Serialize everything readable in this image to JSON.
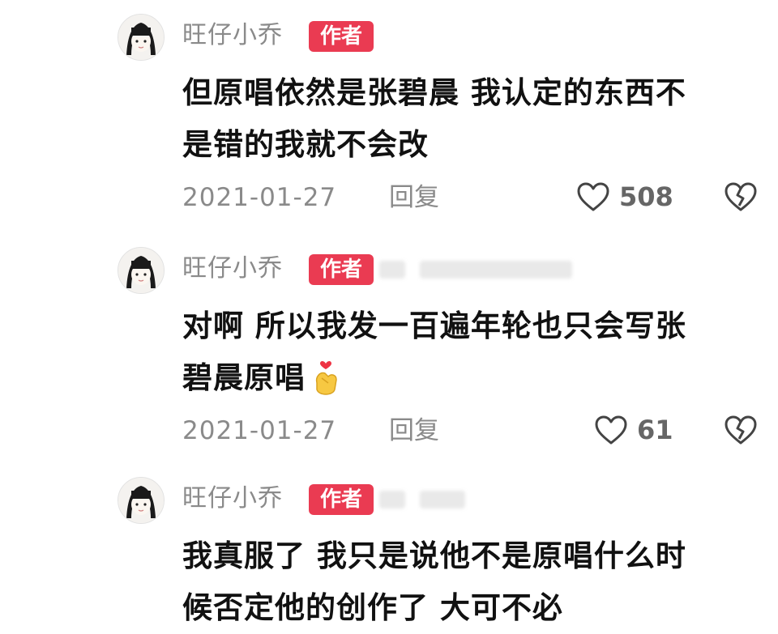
{
  "comments": [
    {
      "username": "旺仔小乔",
      "badge": "作者",
      "lines": [
        "但原唱依然是张碧晨 我认定的东西不",
        "是错的我就不会改"
      ],
      "date": "2021-01-27",
      "reply_label": "回复",
      "likes": "508"
    },
    {
      "username": "旺仔小乔",
      "badge": "作者",
      "lines": [
        "对啊 所以我发一百遍年轮也只会写张",
        "碧晨原唱"
      ],
      "emoji": "heart-hands-emoji",
      "date": "2021-01-27",
      "reply_label": "回复",
      "likes": "61"
    },
    {
      "username": "旺仔小乔",
      "badge": "作者",
      "lines": [
        "我真服了 我只是说他不是原唱什么时",
        "候否定他的创作了 大可不必"
      ]
    }
  ],
  "icons": {
    "like": "heart-outline-icon",
    "dislike": "broken-heart-icon"
  },
  "colors": {
    "badge": "#ea3b52",
    "meta_text": "#8a8a8a",
    "content_text": "#111111"
  }
}
